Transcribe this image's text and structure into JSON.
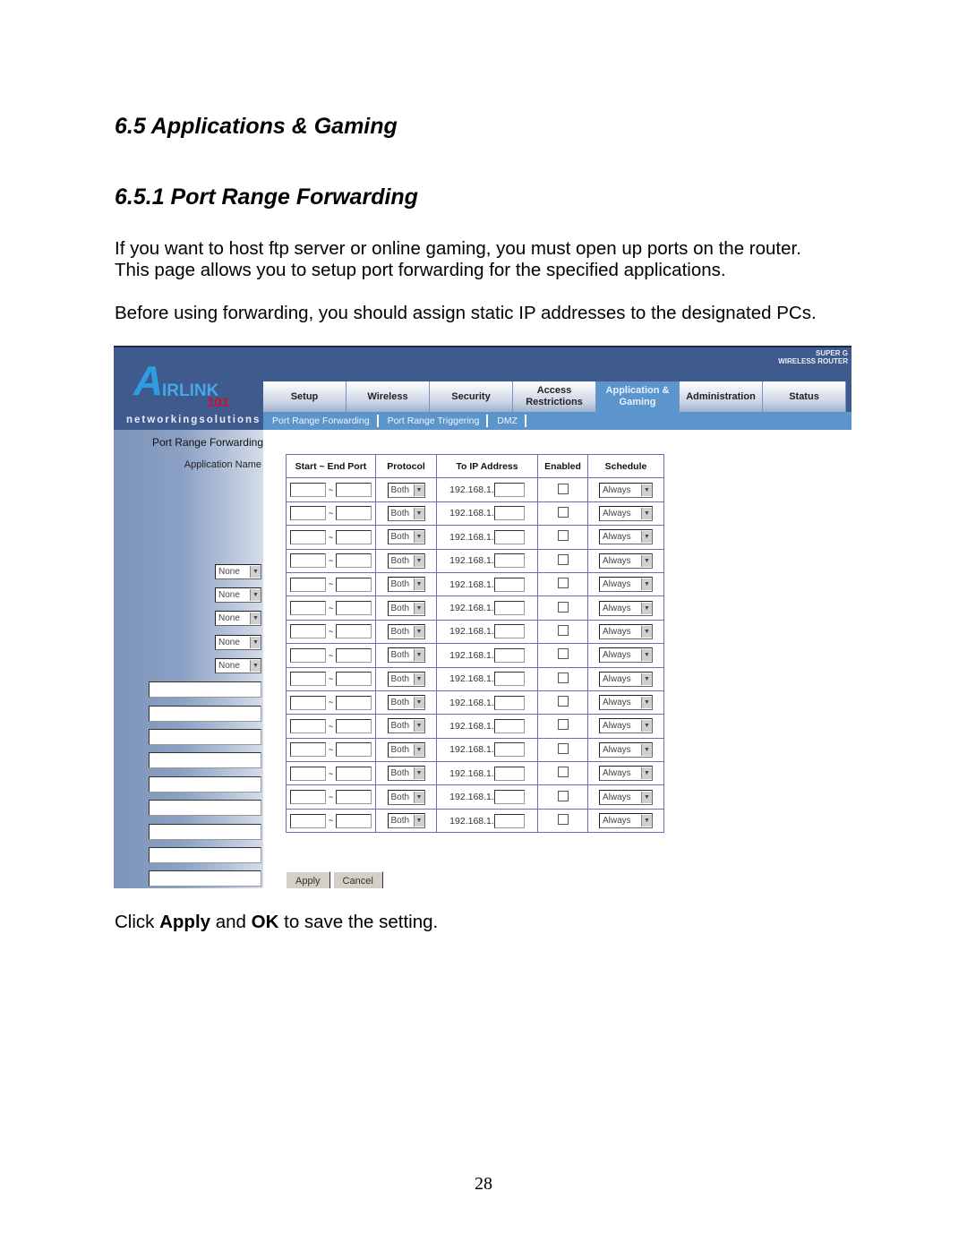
{
  "doc": {
    "heading1": "6.5 Applications & Gaming",
    "heading2": "6.5.1 Port Range Forwarding",
    "para1_line1": "If you want to host ftp server or online gaming, you must open up ports on the router.",
    "para1_line2": "This page allows you to setup port forwarding for the specified applications.",
    "para2": "Before using forwarding, you should assign static IP addresses to the designated PCs.",
    "click_pre": "Click ",
    "click_apply": "Apply",
    "click_and": " and ",
    "click_ok": "OK",
    "click_post": " to save the setting.",
    "page_number": "28"
  },
  "router": {
    "logo": {
      "brand": "AIRLINK 101",
      "tagline": "networkingsolutions",
      "product_line1": "SUPER G",
      "product_line2": "WIRELESS ROUTER"
    },
    "tabs": [
      {
        "label": "Setup"
      },
      {
        "label": "Wireless"
      },
      {
        "label": "Security"
      },
      {
        "label": "Access Restrictions"
      },
      {
        "label": "Application & Gaming",
        "active": true
      },
      {
        "label": "Administration"
      },
      {
        "label": "Status"
      }
    ],
    "subtabs": [
      {
        "label": "Port Range Forwarding"
      },
      {
        "label": "Port Range Triggering"
      },
      {
        "label": "DMZ"
      }
    ],
    "section_title": "Port Range Forwarding",
    "app_name_label": "Application Name",
    "columns": [
      "Start ~ End Port",
      "Protocol",
      "To IP Address",
      "Enabled",
      "Schedule"
    ],
    "ip_prefix": "192.168.1.",
    "port_separator": "~",
    "rows": [
      {
        "app": "None",
        "protocol": "Both",
        "schedule": "Always",
        "enabled": false
      },
      {
        "app": "None",
        "protocol": "Both",
        "schedule": "Always",
        "enabled": false
      },
      {
        "app": "None",
        "protocol": "Both",
        "schedule": "Always",
        "enabled": false
      },
      {
        "app": "None",
        "protocol": "Both",
        "schedule": "Always",
        "enabled": false
      },
      {
        "app": "None",
        "protocol": "Both",
        "schedule": "Always",
        "enabled": false
      },
      {
        "app": "",
        "protocol": "Both",
        "schedule": "Always",
        "enabled": false
      },
      {
        "app": "",
        "protocol": "Both",
        "schedule": "Always",
        "enabled": false
      },
      {
        "app": "",
        "protocol": "Both",
        "schedule": "Always",
        "enabled": false
      },
      {
        "app": "",
        "protocol": "Both",
        "schedule": "Always",
        "enabled": false
      },
      {
        "app": "",
        "protocol": "Both",
        "schedule": "Always",
        "enabled": false
      },
      {
        "app": "",
        "protocol": "Both",
        "schedule": "Always",
        "enabled": false
      },
      {
        "app": "",
        "protocol": "Both",
        "schedule": "Always",
        "enabled": false
      },
      {
        "app": "",
        "protocol": "Both",
        "schedule": "Always",
        "enabled": false
      },
      {
        "app": "",
        "protocol": "Both",
        "schedule": "Always",
        "enabled": false
      },
      {
        "app": "",
        "protocol": "Both",
        "schedule": "Always",
        "enabled": false
      }
    ],
    "apply_label": "Apply",
    "cancel_label": "Cancel"
  }
}
